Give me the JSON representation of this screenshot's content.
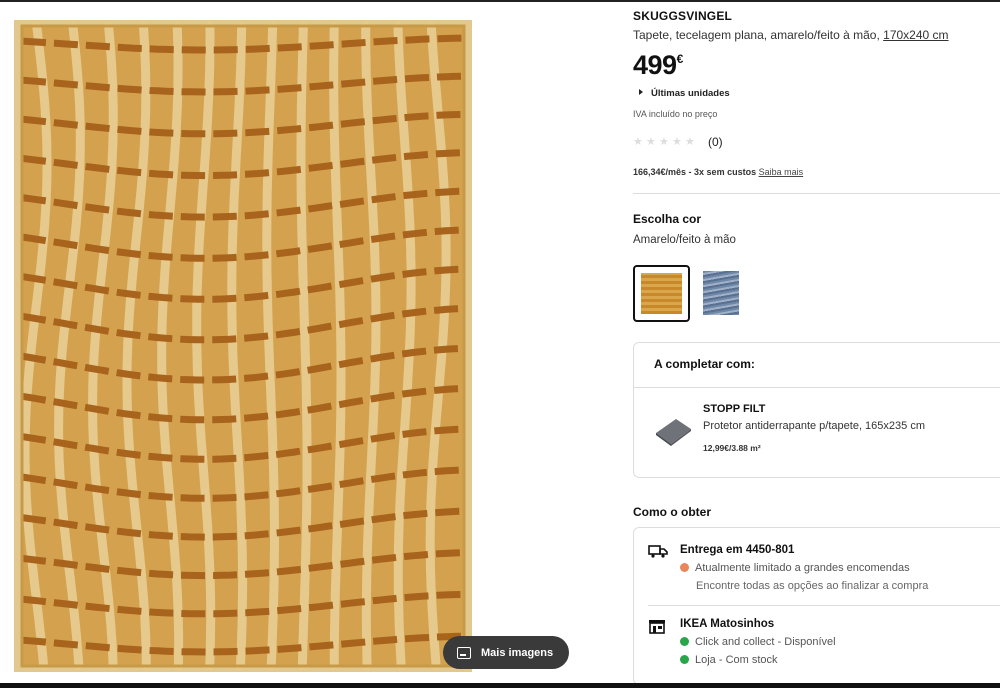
{
  "product": {
    "name": "SKUGGSVINGEL",
    "description": "Tapete, tecelagem plana, amarelo/feito à mão, ",
    "size_link": "170x240 cm",
    "price": "499",
    "currency": "€",
    "stock_label": "Últimas unidades",
    "vat_note": "IVA incluído no preço",
    "rating_count": "(0)",
    "installments_text": "166,34€/mês - 3x sem custos",
    "installments_link": "Saiba mais"
  },
  "gallery": {
    "more_images_label": "Mais imagens"
  },
  "color": {
    "title": "Escolha cor",
    "selected": "Amarelo/feito à mão",
    "swatches": [
      "amarelo",
      "azul"
    ]
  },
  "complete_with": {
    "title": "A completar com:",
    "item_name": "STOPP FILT",
    "item_desc": "Protetor antiderrapante p/tapete, 165x235 cm",
    "item_price": "12,99€/3.88 m²"
  },
  "how_to_get": {
    "title": "Como o obter",
    "delivery_title": "Entrega em 4450-801",
    "delivery_status": "Atualmente limitado a grandes encomendas",
    "delivery_note": "Encontre todas as opções ao finalizar a compra",
    "store_title": "IKEA Matosinhos",
    "store_line1": "Click and collect - Disponível",
    "store_line2": "Loja - Com stock"
  },
  "colors": {
    "rug_base": "#d4a24e",
    "rug_stripe": "#a8641c",
    "rug_pile": "#e6c98c",
    "status_orange": "#e8865c",
    "status_green": "#2aa64a"
  },
  "icons": [
    "image-icon",
    "star-icon",
    "truck-icon",
    "store-icon"
  ]
}
